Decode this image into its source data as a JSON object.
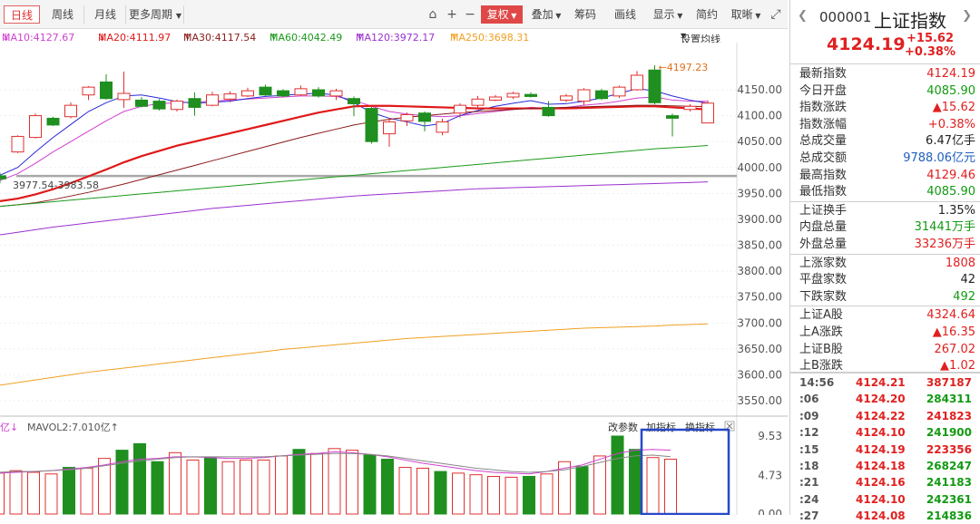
{
  "toolbar": {
    "tabs": [
      "日线",
      "周线",
      "月线",
      "更多周期"
    ],
    "active_tab": "日线",
    "buttons": [
      "复权",
      "叠加",
      "筹码",
      "画线",
      "显示",
      "简约",
      "取晰"
    ],
    "ma_settings": "设置均线"
  },
  "ma_legend": [
    {
      "label": "MA10:4127.67",
      "arrow": "↓",
      "color": "#d040d0"
    },
    {
      "label": "MA20:4111.97",
      "arrow": "↓",
      "color": "#e01818"
    },
    {
      "label": "MA30:4117.54",
      "arrow": "↑",
      "color": "#8b1a1a"
    },
    {
      "label": "MA60:4042.49",
      "arrow": "↑",
      "color": "#1a9a1a"
    },
    {
      "label": "MA120:3972.17",
      "arrow": "↑",
      "color": "#9a30d0"
    },
    {
      "label": "MA250:3698.31",
      "arrow": "↑",
      "color": "#f0a020"
    }
  ],
  "annotations": {
    "high_label": "←4197.23",
    "range_label": "3977.54-3983.58"
  },
  "price_axis": [
    "4150.00",
    "4100.00",
    "4050.00",
    "4000.00",
    "3950.00",
    "3900.00",
    "3850.00",
    "3800.00",
    "3750.00",
    "3700.00",
    "3650.00",
    "3600.00",
    "3550.00"
  ],
  "volume_panel": {
    "legend_prefix": "亿↓",
    "legend": "MAVOL2:7.010亿↑",
    "controls": [
      "改参数",
      "加指标",
      "换指标"
    ],
    "axis": [
      "9.53",
      "4.73",
      "0.00"
    ]
  },
  "quote": {
    "code": "000001",
    "name": "上证指数",
    "price": "4124.19",
    "change": "+15.62",
    "change_pct": "+0.38%",
    "rows": [
      {
        "label": "最新指数",
        "value": "4124.19",
        "color": "red"
      },
      {
        "label": "今日开盘",
        "value": "4085.90",
        "color": "green"
      },
      {
        "label": "指数涨跌",
        "value": "▲15.62",
        "color": "red"
      },
      {
        "label": "指数涨幅",
        "value": "+0.38%",
        "color": "red"
      },
      {
        "label": "总成交量",
        "value": "6.47亿手",
        "color": "black"
      },
      {
        "label": "总成交额",
        "value": "9788.06亿元",
        "color": "blue"
      },
      {
        "label": "最高指数",
        "value": "4129.46",
        "color": "red"
      },
      {
        "label": "最低指数",
        "value": "4085.90",
        "color": "green"
      },
      {
        "label": "上证换手",
        "value": "1.35%",
        "color": "black"
      },
      {
        "label": "内盘总量",
        "value": "31441万手",
        "color": "green"
      },
      {
        "label": "外盘总量",
        "value": "33236万手",
        "color": "red"
      },
      {
        "label": "上涨家数",
        "value": "1808",
        "color": "red"
      },
      {
        "label": "平盘家数",
        "value": "42",
        "color": "black"
      },
      {
        "label": "下跌家数",
        "value": "492",
        "color": "green"
      },
      {
        "label": "上证A股",
        "value": "4324.64",
        "color": "red"
      },
      {
        "label": "上A涨跌",
        "value": "▲16.35",
        "color": "red"
      },
      {
        "label": "上证B股",
        "value": "267.02",
        "color": "red"
      },
      {
        "label": "上B涨跌",
        "value": "▲1.02",
        "color": "red"
      }
    ],
    "ticks": [
      {
        "time": "14:56",
        "price": "4124.21",
        "vol": "387187",
        "vcolor": "red"
      },
      {
        "time": ":06",
        "price": "4124.20",
        "vol": "284311",
        "vcolor": "green"
      },
      {
        "time": ":09",
        "price": "4124.22",
        "vol": "241823",
        "vcolor": "red"
      },
      {
        "time": ":12",
        "price": "4124.10",
        "vol": "241900",
        "vcolor": "green"
      },
      {
        "time": ":15",
        "price": "4124.19",
        "vol": "223356",
        "vcolor": "red"
      },
      {
        "time": ":18",
        "price": "4124.18",
        "vol": "268247",
        "vcolor": "green"
      },
      {
        "time": ":21",
        "price": "4124.16",
        "vol": "241183",
        "vcolor": "green"
      },
      {
        "time": ":24",
        "price": "4124.10",
        "vol": "242361",
        "vcolor": "green"
      },
      {
        "time": ":27",
        "price": "4124.08",
        "vol": "214836",
        "vcolor": "green"
      }
    ]
  },
  "chart_data": {
    "type": "candlestick",
    "price_range": [
      3550,
      4197.23
    ],
    "candles": [
      {
        "o": 3978,
        "c": 3984,
        "h": 3990,
        "l": 3970,
        "up": false
      },
      {
        "o": 4030,
        "c": 4060,
        "h": 4062,
        "l": 4028,
        "up": true
      },
      {
        "o": 4058,
        "c": 4100,
        "h": 4104,
        "l": 4056,
        "up": true
      },
      {
        "o": 4095,
        "c": 4082,
        "h": 4098,
        "l": 4080,
        "up": false
      },
      {
        "o": 4098,
        "c": 4120,
        "h": 4126,
        "l": 4095,
        "up": true
      },
      {
        "o": 4140,
        "c": 4155,
        "h": 4157,
        "l": 4130,
        "up": true
      },
      {
        "o": 4165,
        "c": 4133,
        "h": 4180,
        "l": 4131,
        "up": false
      },
      {
        "o": 4131,
        "c": 4143,
        "h": 4185,
        "l": 4115,
        "up": true
      },
      {
        "o": 4130,
        "c": 4118,
        "h": 4136,
        "l": 4116,
        "up": false
      },
      {
        "o": 4128,
        "c": 4113,
        "h": 4132,
        "l": 4110,
        "up": false
      },
      {
        "o": 4112,
        "c": 4128,
        "h": 4131,
        "l": 4108,
        "up": true
      },
      {
        "o": 4133,
        "c": 4116,
        "h": 4145,
        "l": 4100,
        "up": false
      },
      {
        "o": 4120,
        "c": 4140,
        "h": 4146,
        "l": 4118,
        "up": true
      },
      {
        "o": 4132,
        "c": 4142,
        "h": 4147,
        "l": 4126,
        "up": true
      },
      {
        "o": 4138,
        "c": 4148,
        "h": 4154,
        "l": 4136,
        "up": true
      },
      {
        "o": 4155,
        "c": 4140,
        "h": 4160,
        "l": 4138,
        "up": false
      },
      {
        "o": 4148,
        "c": 4138,
        "h": 4151,
        "l": 4136,
        "up": false
      },
      {
        "o": 4140,
        "c": 4152,
        "h": 4158,
        "l": 4138,
        "up": true
      },
      {
        "o": 4150,
        "c": 4138,
        "h": 4155,
        "l": 4135,
        "up": false
      },
      {
        "o": 4138,
        "c": 4148,
        "h": 4152,
        "l": 4130,
        "up": true
      },
      {
        "o": 4133,
        "c": 4123,
        "h": 4137,
        "l": 4099,
        "up": false
      },
      {
        "o": 4114,
        "c": 4050,
        "h": 4117,
        "l": 4046,
        "up": false
      },
      {
        "o": 4065,
        "c": 4088,
        "h": 4096,
        "l": 4040,
        "up": true
      },
      {
        "o": 4090,
        "c": 4102,
        "h": 4106,
        "l": 4080,
        "up": true
      },
      {
        "o": 4105,
        "c": 4089,
        "h": 4108,
        "l": 4070,
        "up": false
      },
      {
        "o": 4068,
        "c": 4088,
        "h": 4094,
        "l": 4062,
        "up": true
      },
      {
        "o": 4105,
        "c": 4120,
        "h": 4124,
        "l": 4096,
        "up": true
      },
      {
        "o": 4120,
        "c": 4132,
        "h": 4138,
        "l": 4116,
        "up": true
      },
      {
        "o": 4130,
        "c": 4136,
        "h": 4140,
        "l": 4128,
        "up": true
      },
      {
        "o": 4136,
        "c": 4143,
        "h": 4146,
        "l": 4132,
        "up": true
      },
      {
        "o": 4141,
        "c": 4137,
        "h": 4145,
        "l": 4135,
        "up": false
      },
      {
        "o": 4116,
        "c": 4100,
        "h": 4128,
        "l": 4098,
        "up": false
      },
      {
        "o": 4130,
        "c": 4138,
        "h": 4142,
        "l": 4126,
        "up": true
      },
      {
        "o": 4128,
        "c": 4150,
        "h": 4153,
        "l": 4120,
        "up": true
      },
      {
        "o": 4148,
        "c": 4133,
        "h": 4152,
        "l": 4130,
        "up": false
      },
      {
        "o": 4138,
        "c": 4155,
        "h": 4158,
        "l": 4134,
        "up": true
      },
      {
        "o": 4150,
        "c": 4178,
        "h": 4186,
        "l": 4148,
        "up": true
      },
      {
        "o": 4188,
        "c": 4125,
        "h": 4197.23,
        "l": 4122,
        "up": false
      },
      {
        "o": 4100,
        "c": 4095,
        "h": 4104,
        "l": 4060,
        "up": false
      },
      {
        "o": 4112,
        "c": 4118,
        "h": 4122,
        "l": 4108,
        "up": true
      },
      {
        "o": 4085.9,
        "c": 4124.19,
        "h": 4129.46,
        "l": 4085.9,
        "up": true
      }
    ],
    "volume_range": [
      0,
      9.53
    ],
    "volumes": [
      {
        "v": 5.0,
        "up": true
      },
      {
        "v": 5.3,
        "up": true
      },
      {
        "v": 5.1,
        "up": true
      },
      {
        "v": 4.9,
        "up": true
      },
      {
        "v": 5.7,
        "up": false
      },
      {
        "v": 5.6,
        "up": true
      },
      {
        "v": 6.8,
        "up": true
      },
      {
        "v": 7.8,
        "up": false
      },
      {
        "v": 8.6,
        "up": false
      },
      {
        "v": 6.4,
        "up": false
      },
      {
        "v": 7.5,
        "up": true
      },
      {
        "v": 6.6,
        "up": true
      },
      {
        "v": 6.9,
        "up": false
      },
      {
        "v": 6.4,
        "up": true
      },
      {
        "v": 6.6,
        "up": true
      },
      {
        "v": 6.6,
        "up": true
      },
      {
        "v": 7.1,
        "up": true
      },
      {
        "v": 7.9,
        "up": false
      },
      {
        "v": 7.4,
        "up": true
      },
      {
        "v": 8.0,
        "up": true
      },
      {
        "v": 7.8,
        "up": true
      },
      {
        "v": 7.2,
        "up": false
      },
      {
        "v": 6.7,
        "up": false
      },
      {
        "v": 5.7,
        "up": true
      },
      {
        "v": 5.6,
        "up": true
      },
      {
        "v": 5.2,
        "up": false
      },
      {
        "v": 5.0,
        "up": true
      },
      {
        "v": 4.8,
        "up": true
      },
      {
        "v": 4.6,
        "up": true
      },
      {
        "v": 4.5,
        "up": true
      },
      {
        "v": 4.6,
        "up": false
      },
      {
        "v": 4.9,
        "up": true
      },
      {
        "v": 6.4,
        "up": true
      },
      {
        "v": 5.8,
        "up": false
      },
      {
        "v": 7.1,
        "up": true
      },
      {
        "v": 9.53,
        "up": false
      },
      {
        "v": 7.9,
        "up": false
      },
      {
        "v": 6.9,
        "up": true
      },
      {
        "v": 6.7,
        "up": true
      }
    ],
    "ma_lines": [
      {
        "name": "MA10",
        "color": "#d040d0",
        "values": [
          3975,
          3988,
          4008,
          4030,
          4050,
          4070,
          4090,
          4108,
          4118,
          4123,
          4125,
          4126,
          4128,
          4130,
          4132,
          4134,
          4136,
          4138,
          4138,
          4137,
          4130,
          4118,
          4108,
          4103,
          4100,
          4098,
          4100,
          4104,
          4108,
          4112,
          4116,
          4114,
          4116,
          4120,
          4123,
          4128,
          4134,
          4136,
          4130,
          4128,
          4127.67
        ]
      },
      {
        "name": "MA5",
        "color": "#2828d8",
        "values": [
          3985,
          4000,
          4030,
          4058,
          4083,
          4108,
          4125,
          4138,
          4140,
          4134,
          4127,
          4124,
          4126,
          4128,
          4133,
          4137,
          4139,
          4142,
          4143,
          4140,
          4125,
          4106,
          4095,
          4088,
          4080,
          4085,
          4100,
          4110,
          4118,
          4124,
          4129,
          4122,
          4123,
          4128,
          4134,
          4143,
          4152,
          4148,
          4138,
          4130,
          4124
        ]
      },
      {
        "name": "MA20",
        "color": "#e01818",
        "values": [
          3935,
          3940,
          3948,
          3958,
          3970,
          3983,
          3996,
          4010,
          4022,
          4032,
          4042,
          4050,
          4058,
          4066,
          4074,
          4082,
          4090,
          4098,
          4106,
          4112,
          4118,
          4119,
          4119,
          4118,
          4117,
          4116,
          4115,
          4114,
          4114,
          4114,
          4114,
          4114,
          4114,
          4115,
          4116,
          4117,
          4118,
          4118,
          4116,
          4114,
          4111.97
        ]
      },
      {
        "name": "MA30",
        "color": "#8b1a1a",
        "values": [
          3925,
          3928,
          3932,
          3938,
          3945,
          3952,
          3960,
          3968,
          3977,
          3986,
          3995,
          4004,
          4013,
          4022,
          4031,
          4040,
          4049,
          4058,
          4066,
          4074,
          4082,
          4088,
          4093,
          4097,
          4100,
          4103,
          4106,
          4108,
          4110,
          4112,
          4114,
          4115,
          4116,
          4117,
          4118,
          4119,
          4120,
          4120,
          4119,
          4118,
          4117.54
        ]
      },
      {
        "name": "MA60",
        "color": "#1a9a1a",
        "values": [
          3925,
          3928,
          3931,
          3934,
          3937,
          3940,
          3943,
          3946,
          3949,
          3952,
          3955,
          3958,
          3961,
          3964,
          3967,
          3970,
          3973,
          3976,
          3979,
          3982,
          3985,
          3988,
          3991,
          3994,
          3997,
          4000,
          4003,
          4006,
          4009,
          4012,
          4015,
          4018,
          4021,
          4024,
          4027,
          4030,
          4033,
          4036,
          4038,
          4040,
          4042.49
        ]
      },
      {
        "name": "MA120",
        "color": "#9a30d0",
        "values": [
          3870,
          3875,
          3880,
          3885,
          3889,
          3893,
          3897,
          3901,
          3905,
          3909,
          3913,
          3917,
          3921,
          3924,
          3927,
          3930,
          3933,
          3936,
          3939,
          3942,
          3945,
          3947,
          3949,
          3951,
          3953,
          3955,
          3957,
          3959,
          3960,
          3961,
          3962,
          3963,
          3964,
          3965,
          3966,
          3967,
          3968,
          3969,
          3970,
          3971,
          3972.17
        ]
      },
      {
        "name": "MA250",
        "color": "#f0a020",
        "values": [
          3580,
          3585,
          3590,
          3595,
          3600,
          3605,
          3609,
          3613,
          3617,
          3621,
          3625,
          3629,
          3633,
          3637,
          3641,
          3645,
          3649,
          3652,
          3655,
          3658,
          3661,
          3664,
          3667,
          3670,
          3672,
          3674,
          3676,
          3678,
          3680,
          3682,
          3684,
          3686,
          3688,
          3690,
          3691,
          3692,
          3693,
          3694,
          3696,
          3697,
          3698.31
        ]
      }
    ],
    "vol_ma_lines": [
      {
        "name": "MAVOL1",
        "color": "#d040d0",
        "values": [
          5.0,
          5.1,
          5.2,
          5.3,
          5.5,
          5.7,
          6.0,
          6.4,
          6.7,
          6.8,
          7.0,
          7.0,
          6.9,
          6.8,
          6.8,
          6.9,
          7.1,
          7.3,
          7.4,
          7.6,
          7.5,
          7.3,
          7.0,
          6.6,
          6.2,
          5.9,
          5.6,
          5.3,
          5.1,
          5.0,
          4.9,
          5.2,
          5.6,
          6.0,
          6.7,
          7.4,
          7.8,
          7.9,
          7.8
        ]
      },
      {
        "name": "MAVOL2",
        "color": "#888888",
        "values": [
          5.1,
          5.2,
          5.2,
          5.3,
          5.4,
          5.6,
          5.9,
          6.2,
          6.5,
          6.7,
          6.9,
          7.0,
          7.0,
          7.0,
          7.0,
          7.0,
          7.1,
          7.2,
          7.3,
          7.4,
          7.4,
          7.3,
          7.1,
          6.8,
          6.5,
          6.2,
          5.9,
          5.6,
          5.4,
          5.2,
          5.1,
          5.2,
          5.4,
          5.8,
          6.3,
          6.8,
          7.1,
          7.2,
          7.01
        ]
      }
    ]
  }
}
